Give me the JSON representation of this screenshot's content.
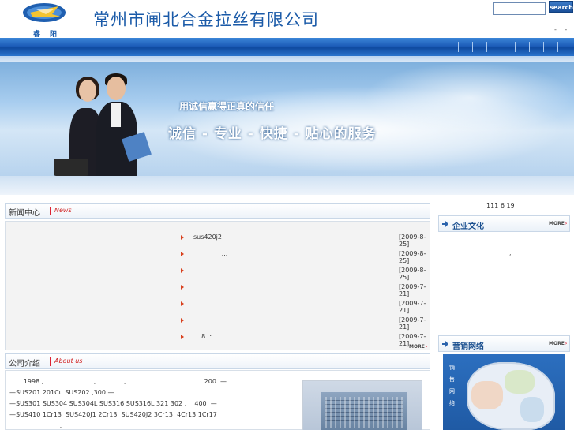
{
  "header": {
    "logo_text": "睿阳",
    "company_name": "常州市闸北合金拉丝有限公司",
    "search_placeholder": "",
    "search_button": "search",
    "top_links": "- -"
  },
  "banner": {
    "slogan_small": "用诚信赢得正真的信任",
    "slogan_large": "诚信 - 专业 - 快捷 - 贴心的服务"
  },
  "news": {
    "title_cn": "新闻中心",
    "title_en": "News",
    "items": [
      {
        "title": "sus420j2",
        "date": "[2009-8-25]"
      },
      {
        "title": "              ...",
        "date": "[2009-8-25]"
      },
      {
        "title": "",
        "date": "[2009-8-25]"
      },
      {
        "title": "",
        "date": "[2009-7-21]"
      },
      {
        "title": "",
        "date": "[2009-7-21]"
      },
      {
        "title": "",
        "date": "[2009-7-21]"
      },
      {
        "title": "    8  :    ...",
        "date": "[2009-7-21]"
      }
    ],
    "more_label": "MORE"
  },
  "about": {
    "title_cn": "公司介绍",
    "title_en": "About us",
    "lines": [
      "       1998 ,                         ,              ,                                       200  —",
      "—SUS201 201Cu SUS202 ,300 —",
      "—SUS301 SUS304 SUS304L SUS316 SUS316L 321 302 ,    400  —",
      "—SUS410 1Cr13  SUS420J1 2Cr13  SUS420J2 3Cr13  4Cr13 1Cr17",
      "                         ,"
    ]
  },
  "right": {
    "date_text": "111 6 19",
    "culture_title": "企业文化",
    "culture_more": "MORE",
    "culture_text": ",",
    "sales_title": "营销网络",
    "sales_more": "MORE",
    "map_label": "销售网络"
  }
}
